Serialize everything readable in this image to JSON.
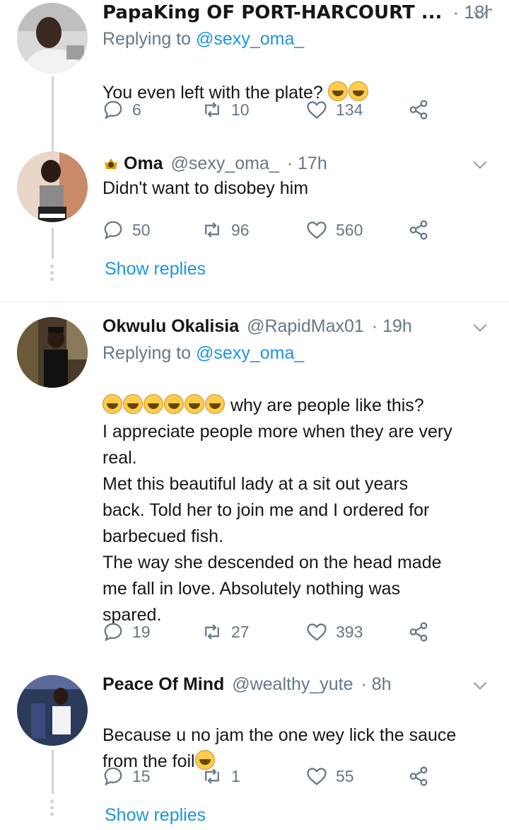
{
  "tweets": [
    {
      "name": "PapaKing OF PORT-HARCOURT ...",
      "handle": "",
      "time": "· 18h",
      "reply_prefix": "Replying to ",
      "reply_to": "@sexy_oma_",
      "text": "You even left with the plate? ",
      "emoji_count": 2,
      "reply_count": "6",
      "retweet_count": "10",
      "like_count": "134"
    },
    {
      "name": "Oma",
      "handle": "@sexy_oma_",
      "time": "· 17h",
      "text": "Didn't want to disobey him",
      "reply_count": "50",
      "retweet_count": "96",
      "like_count": "560",
      "show_replies": "Show replies"
    },
    {
      "name": "Okwulu Okalisia",
      "handle": "@RapidMax01",
      "time": "· 19h",
      "reply_prefix": "Replying to ",
      "reply_to": "@sexy_oma_",
      "text_first": " why are people like this?",
      "text_rest": "I appreciate people more when they are very\nreal.\nMet this beautiful lady at a sit out years\nback. Told her to join me and I ordered for\nbarbecued fish.\nThe way she descended on the head made\nme fall in love. Absolutely nothing was\nspared.",
      "emoji_count": 6,
      "reply_count": "19",
      "retweet_count": "27",
      "like_count": "393"
    },
    {
      "name": "Peace Of Mind",
      "handle": "@wealthy_yute",
      "time": "· 8h",
      "text": "Because u no jam the one wey lick the sauce\nfrom the foil",
      "reply_count": "15",
      "retweet_count": "1",
      "like_count": "55",
      "show_replies": "Show replies"
    }
  ],
  "icons": {
    "reply": "reply-icon",
    "retweet": "retweet-icon",
    "like": "heart-icon",
    "share": "share-icon",
    "menu": "chevron-down-icon"
  },
  "colors": {
    "link": "#1b95e0",
    "muted": "#657786",
    "thread_line": "#ccd6dd"
  }
}
